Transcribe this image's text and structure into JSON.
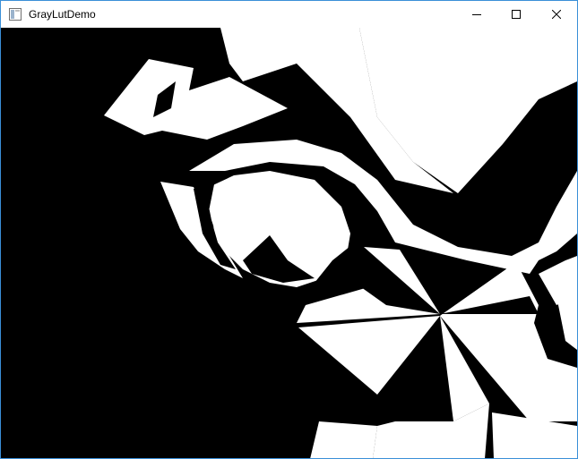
{
  "window": {
    "title": "GrayLutDemo",
    "border_color": "#3a8fd8",
    "icons": {
      "app": "app-window-icon",
      "minimize": "minimize-icon",
      "maximize": "maximize-icon",
      "close": "close-icon"
    }
  },
  "canvas": {
    "foreground": "#ffffff",
    "background": "#000000"
  }
}
